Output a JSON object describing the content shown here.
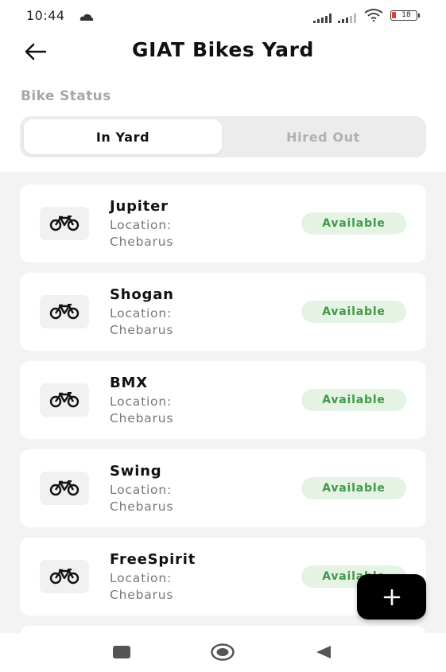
{
  "status_bar": {
    "time": "10:44",
    "battery_level": "18",
    "icons": [
      "cloud-icon",
      "signal-icon",
      "signal-icon",
      "wifi-icon",
      "battery-icon"
    ]
  },
  "header": {
    "title": "GIAT Bikes Yard",
    "back_icon": "arrow-left-icon"
  },
  "section_label": "Bike Status",
  "tabs": [
    {
      "label": "In Yard",
      "active": true
    },
    {
      "label": "Hired Out",
      "active": false
    }
  ],
  "bikes": [
    {
      "name": "Jupiter",
      "location": "Location: Chebarus",
      "status": "Available"
    },
    {
      "name": "Shogan",
      "location": "Location: Chebarus",
      "status": "Available"
    },
    {
      "name": "BMX",
      "location": "Location: Chebarus",
      "status": "Available"
    },
    {
      "name": "Swing",
      "location": "Location: Chebarus",
      "status": "Available"
    },
    {
      "name": "FreeSpirit",
      "location": "Location: Chebarus",
      "status": "Available"
    }
  ],
  "fab": {
    "icon": "plus-icon"
  },
  "nav_bar": {
    "icons": [
      "recents-square-icon",
      "home-circle-icon",
      "back-triangle-icon"
    ]
  },
  "colors": {
    "accent": "#000000",
    "badge_bg": "#e5f3e5",
    "badge_text": "#3f9a45",
    "muted_text": "#a7a7a7",
    "list_bg": "#f3f3f3"
  }
}
